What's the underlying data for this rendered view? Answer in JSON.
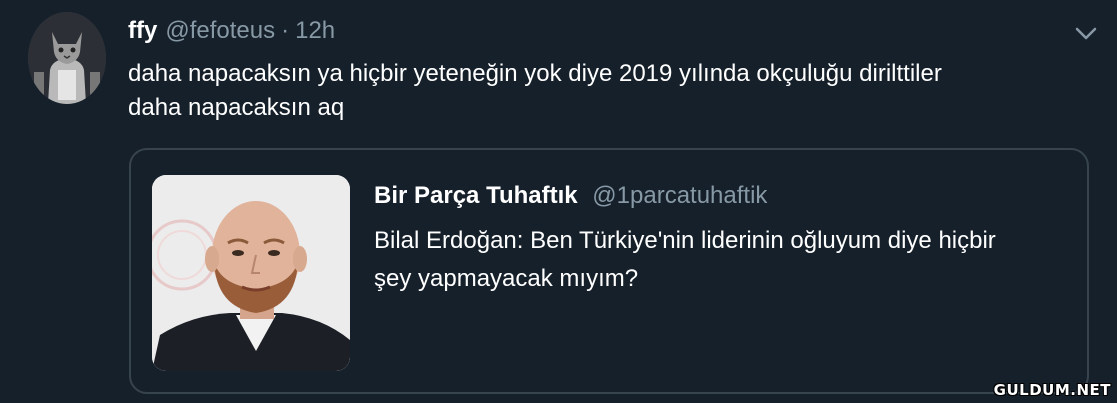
{
  "tweet": {
    "author_name": "ffy",
    "author_handle": "@fefoteus",
    "separator": "·",
    "time": "12h",
    "text_lines": [
      "daha napacaksın ya hiçbir yeteneğin yok diye 2019 yılında okçuluğu dirilttiler",
      "daha napacaksın aq"
    ],
    "avatar_icon": "cat-avatar-icon",
    "menu_icon": "chevron-down-icon"
  },
  "quoted_tweet": {
    "author_name": "Bir Parça Tuhaftık",
    "author_handle": "@1parcatuhaftik",
    "text_lines": [
      "Bilal Erdoğan: Ben Türkiye'nin liderinin oğluyum diye hiçbir",
      "şey yapmayacak mıyım?"
    ],
    "photo_icon": "person-photo"
  },
  "watermark": "GULDUM.NET",
  "colors": {
    "background": "#15202b",
    "border": "#38444d",
    "secondary_text": "#8899a6",
    "primary_text": "#ffffff"
  }
}
